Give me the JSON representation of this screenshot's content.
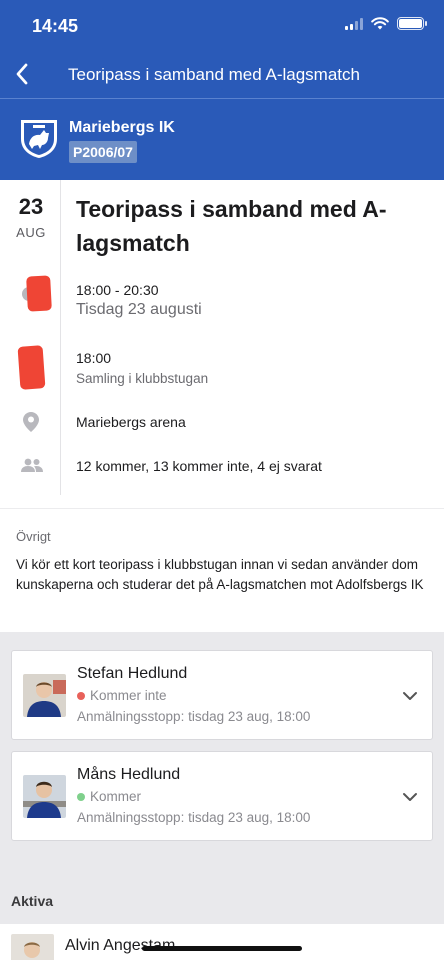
{
  "status_bar": {
    "time": "14:45"
  },
  "nav": {
    "title": "Teoripass i samband med A-lagsmatch",
    "back_icon": "chevron-left-icon"
  },
  "team": {
    "name": "Mariebergs IK",
    "group": "P2006/07"
  },
  "event": {
    "day": "23",
    "month": "AUG",
    "title": "Teoripass i samband med A-lagsmatch",
    "time_range": "18:00 - 20:30",
    "date_text": "Tisdag 23 augusti",
    "gather_time": "18:00",
    "gather_place": "Samling i klubbstugan",
    "location": "Mariebergs arena",
    "attendance": "12 kommer, 13 kommer inte, 4 ej svarat"
  },
  "notes": {
    "heading": "Övrigt",
    "text": "Vi kör ett kort teoripass i klubbstugan innan vi sedan använder dom kunskaperna och studerar det på A-lagsmatchen mot Adolfsbergs IK"
  },
  "participants": [
    {
      "name": "Stefan Hedlund",
      "status": "Kommer inte",
      "status_color": "#e8615a",
      "deadline": "Anmälningsstopp: tisdag 23 aug, 18:00"
    },
    {
      "name": "Måns Hedlund",
      "status": "Kommer",
      "status_color": "#7fd08c",
      "deadline": "Anmälningsstopp: tisdag 23 aug, 18:00"
    }
  ],
  "active_section": {
    "title": "Aktiva",
    "first_member": "Alvin Angestam"
  },
  "colors": {
    "brand": "#2a5ab8",
    "background": "#e9e9ec"
  }
}
